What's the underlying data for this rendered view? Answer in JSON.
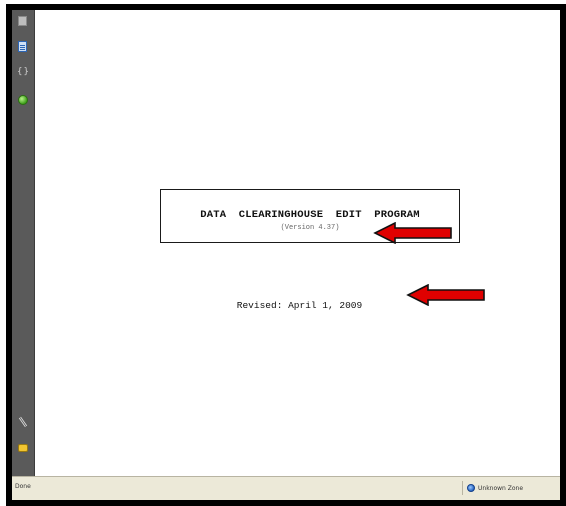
{
  "sidebar": {
    "icons": [
      "page-icon",
      "document-icon",
      "pair-icon",
      "green-circle-icon",
      "paperclip-icon",
      "comment-icon"
    ]
  },
  "document": {
    "title": "DATA  CLEARINGHOUSE  EDIT  PROGRAM",
    "version": "(Version 4.37)",
    "revised": "Revised: April 1, 2009"
  },
  "annotations": {
    "arrow_color": "#e00000"
  },
  "statusbar": {
    "left_text": "Done",
    "zone_label": "Unknown Zone"
  },
  "colors": {
    "frame": "#000000",
    "sidebar": "#5a5a5a",
    "statusbar": "#ece9d8",
    "page": "#ffffff"
  }
}
